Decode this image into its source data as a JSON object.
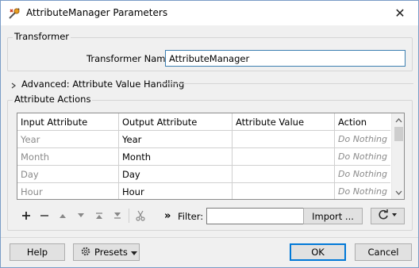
{
  "window": {
    "title": "AttributeManager Parameters",
    "close_glyph": "✕",
    "app_icon": "fme-transformer-icon"
  },
  "transformer_group": {
    "label": "Transformer",
    "name_label": "Transformer Name:",
    "name_value": "AttributeManager"
  },
  "advanced": {
    "label": "Advanced: Attribute Value Handling",
    "expanded": false
  },
  "attribute_actions": {
    "label": "Attribute Actions",
    "columns": [
      "Input Attribute",
      "Output Attribute",
      "Attribute Value",
      "Action"
    ],
    "rows": [
      {
        "input": "Year",
        "output": "Year",
        "value": "",
        "action": "Do Nothing"
      },
      {
        "input": "Month",
        "output": "Month",
        "value": "",
        "action": "Do Nothing"
      },
      {
        "input": "Day",
        "output": "Day",
        "value": "",
        "action": "Do Nothing"
      },
      {
        "input": "Hour",
        "output": "Hour",
        "value": "",
        "action": "Do Nothing"
      }
    ]
  },
  "toolbar": {
    "filter_label": "Filter:",
    "filter_value": "",
    "import_label": "Import ...",
    "expand_glyph": "»"
  },
  "footer": {
    "help_label": "Help",
    "presets_label": "Presets",
    "ok_label": "OK",
    "cancel_label": "Cancel"
  },
  "colors": {
    "accent": "#0078d7",
    "focus_border": "#3c7fb1",
    "muted_text": "#8a8a8a"
  }
}
